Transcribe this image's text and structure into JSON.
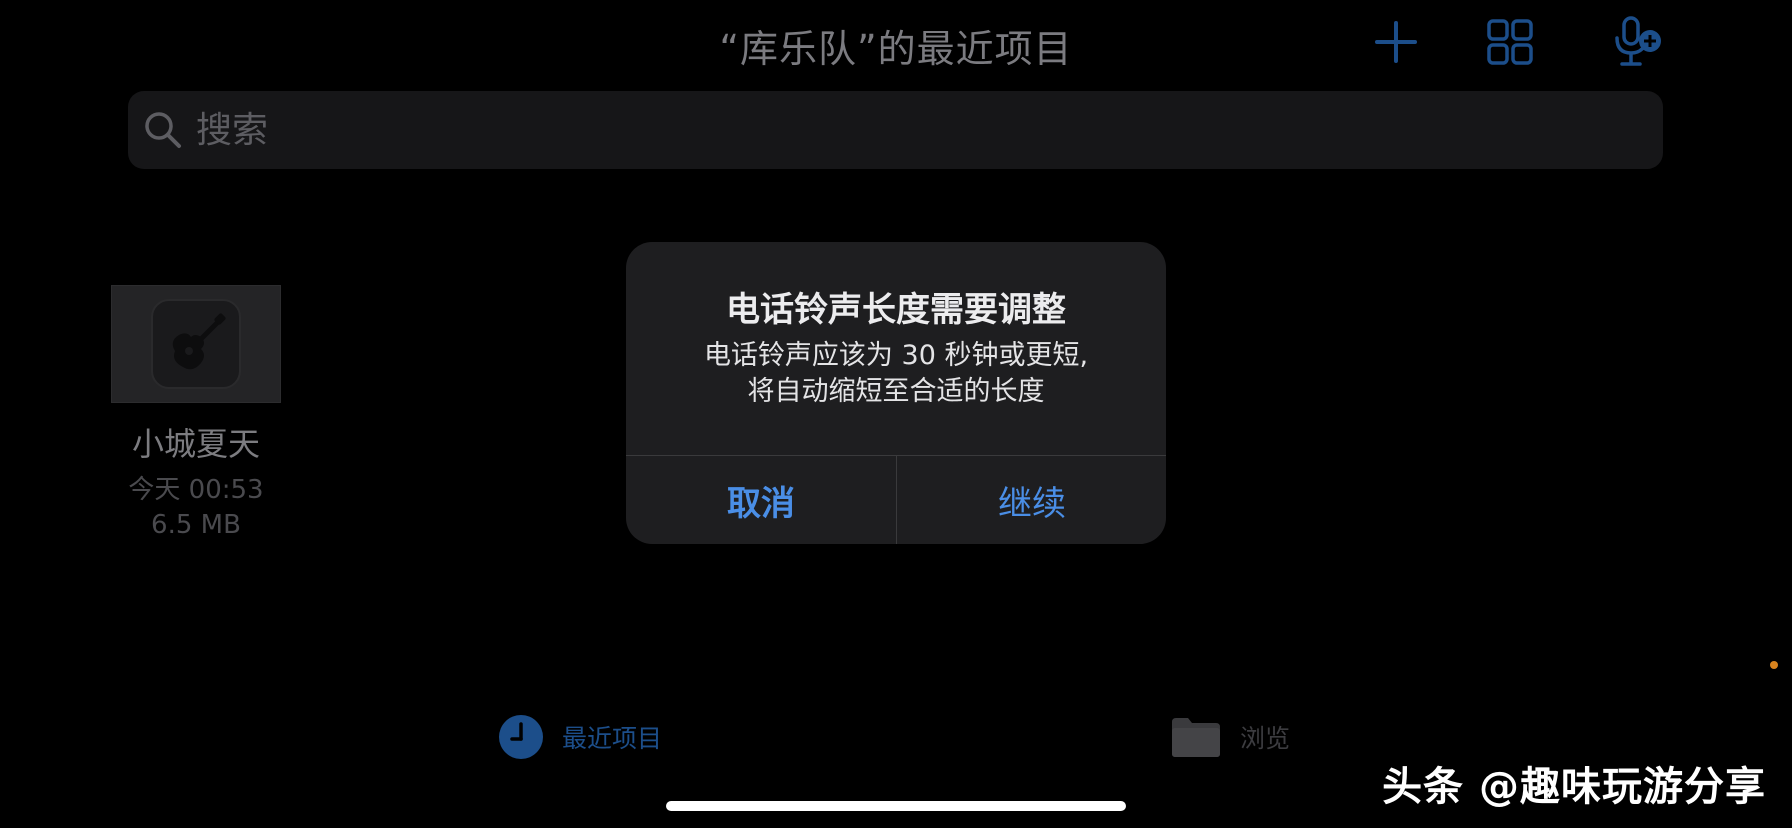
{
  "header": {
    "title": "“库乐队”的最近项目",
    "add_icon": "plus-icon",
    "grid_icon": "grid-view-icon",
    "mic_icon": "microphone-add-icon",
    "accent_color": "#1c4e8a"
  },
  "search": {
    "placeholder": "搜索",
    "value": ""
  },
  "projects": [
    {
      "name": "小城夏天",
      "date": "今天 00:53",
      "size": "6.5 MB",
      "icon": "guitar-icon"
    }
  ],
  "alert": {
    "title": "电话铃声长度需要调整",
    "message_line1": "电话铃声应该为 30 秒钟或更短,",
    "message_line2": "将自动缩短至合适的长度",
    "cancel_label": "取消",
    "continue_label": "继续",
    "button_color": "#4a8ee6"
  },
  "tabbar": {
    "recent_label": "最近项目",
    "recent_icon": "clock-icon",
    "browse_label": "浏览",
    "browse_icon": "folder-icon",
    "active_tab": "recent"
  },
  "watermark": {
    "text": "头条 @趣味玩游分享"
  }
}
